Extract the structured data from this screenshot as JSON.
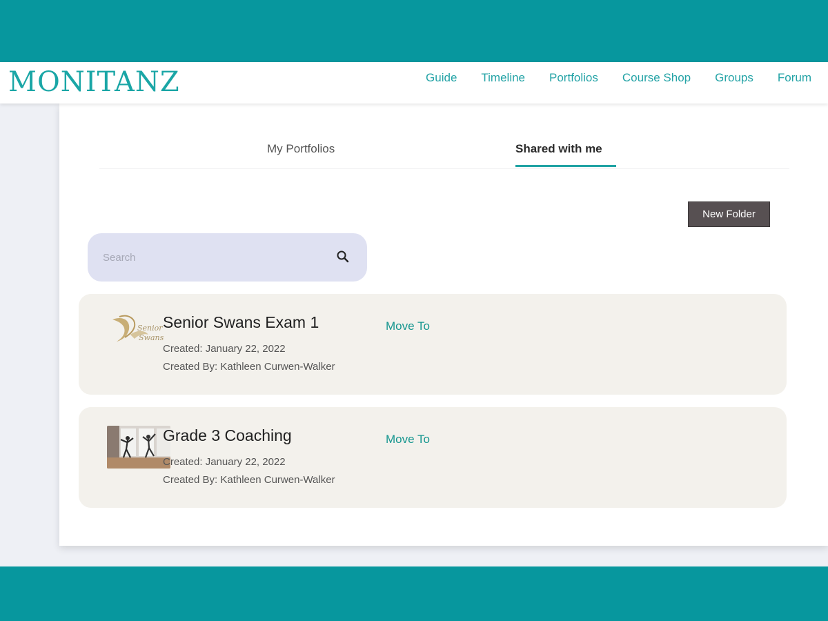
{
  "brand": {
    "logo_text": "MONITANZ",
    "accent": "#1aa6a6",
    "frame_color": "#07979e"
  },
  "nav": {
    "items": [
      "Guide",
      "Timeline",
      "Portfolios",
      "Course Shop",
      "Groups",
      "Forum"
    ]
  },
  "tabs": {
    "mine": "My Portfolios",
    "shared": "Shared with me",
    "active": "shared"
  },
  "actions": {
    "new_folder": "New Folder"
  },
  "search": {
    "placeholder": "Search",
    "value": ""
  },
  "portfolios": [
    {
      "title": "Senior Swans Exam 1",
      "created": "Created: January 22, 2022",
      "created_by": "Created By: Kathleen Curwen-Walker",
      "action": "Move To",
      "thumbnail": "senior-swans-logo-thumbnail"
    },
    {
      "title": "Grade 3 Coaching",
      "created": "Created: January 22, 2022",
      "created_by": "Created By: Kathleen Curwen-Walker",
      "action": "Move To",
      "thumbnail": "dance-studio-photo-thumbnail"
    }
  ]
}
